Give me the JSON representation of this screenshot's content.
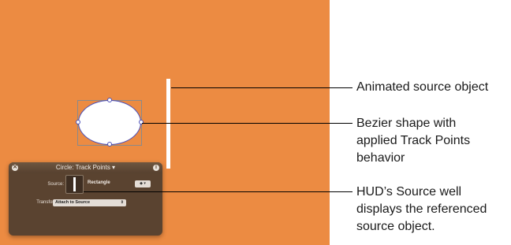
{
  "hud": {
    "title": "Circle: Track Points ▾",
    "close_glyph": "✕",
    "info_glyph": "i",
    "source_label": "Source:",
    "source_name": "Rectangle",
    "source_menu_glyph": "◆ ▾",
    "transform_label": "Transform:",
    "transform_value": "Attach to Source",
    "transform_arrow": "⇕"
  },
  "callouts": [
    {
      "text": "Animated source object"
    },
    {
      "line1": "Bezier shape with",
      "line2": "applied Track Points",
      "line3": "behavior"
    },
    {
      "line1": "HUD’s Source well",
      "line2": "displays the referenced",
      "line3": "source object."
    }
  ],
  "colors": {
    "canvas": "#ec8b42",
    "hud": "#5a4330",
    "shape_outline": "#4a4fb8"
  }
}
